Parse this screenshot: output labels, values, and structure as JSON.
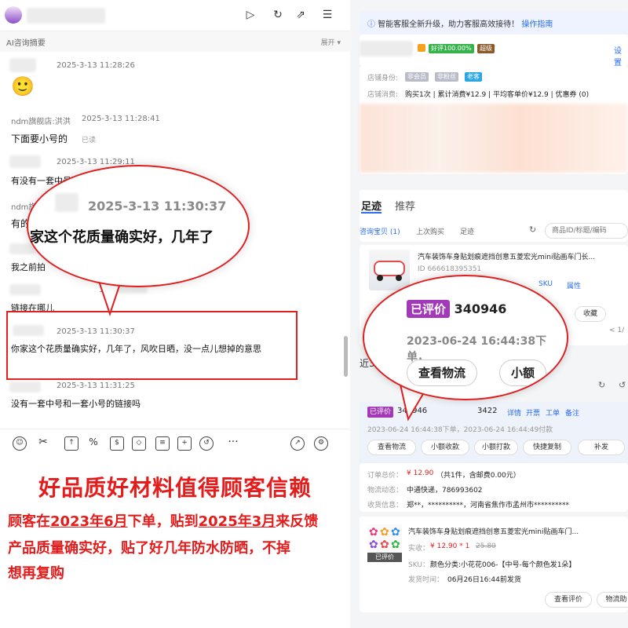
{
  "chat": {
    "ai_summary": "AI咨询摘要",
    "expand": "展开 ▾",
    "messages": [
      {
        "ts": "2025-3-13 11:28:26",
        "emoji": "🙂"
      },
      {
        "sender": "ndm旗舰店:洪洪",
        "ts": "2025-3-13 11:28:41",
        "text": "下面要小号的",
        "status": "已读"
      },
      {
        "ts": "2025-3-13 11:29:11",
        "text": "有没有一套中号"
      },
      {
        "sender": "ndm旗",
        "text": "有的"
      },
      {
        "text": "我之前拍"
      },
      {
        "ts": "11",
        "text": "链接在哪儿"
      },
      {
        "ts": "2025-3-13 11:30:37",
        "text": "你家这个花质量确实好，几年了，风吹日晒，没一点儿想掉的意思"
      },
      {
        "ts": "2025-3-13 11:31:25",
        "text": "没有一套中号和一套小号的链接吗"
      }
    ],
    "bubble": {
      "ts": "2025-3-13 11:30:37",
      "text": "家这个花质量确实好，几年了"
    }
  },
  "caption": {
    "headline": "好品质好材料值得顾客信赖",
    "line1_a": "顾客在",
    "line1_b": "2023年6月",
    "line1_c": "下单，贴到",
    "line1_d": "2025年3月",
    "line1_e": "来反馈",
    "line2": "产品质量确实好，贴了好几年防水防晒，不掉",
    "line3": "想再复购"
  },
  "right": {
    "notice": "智能客服全新升级，助力客服高效接待！",
    "notice_link": "操作指南",
    "settings": "设置",
    "badge_rate": "好评100.00%",
    "badge_level": "超级",
    "shop_identity_label": "店铺身份:",
    "tags": [
      "非会员",
      "非粉丝",
      "老客"
    ],
    "shop_spend_label": "店铺消费:",
    "shop_spend": "购买1次 | 累计消费¥12.9 | 平均客单价¥12.9 | 优惠券 (0)",
    "tabs": [
      "足迹",
      "推荐"
    ],
    "subtabs": [
      "咨询宝贝 (1)",
      "上次购买",
      "足迹"
    ],
    "search_placeholder": "商品ID/标题/编码",
    "product_title": "汽车装饰车身贴划痕遮挡创意五菱宏光mini贴画车门长...",
    "product_id": "ID 666618395351",
    "sku": "SKU",
    "attr": "属性",
    "collect": "收藏",
    "page": "< 1/",
    "recent": "近3",
    "zoom": {
      "status": "已评价",
      "order": "340946",
      "time": "2023-06-24 16:44:38下单，",
      "btn1": "查看物流",
      "btn2": "小额"
    },
    "order": {
      "status": "已评价",
      "id_a": "340946",
      "id_b": "3422",
      "links": [
        "详情",
        "开票",
        "工单",
        "备注"
      ],
      "times": "2023-06-24 16:44:38下单，2023-06-24 16:44:49付款",
      "buttons": [
        "查看物流",
        "小额收款",
        "小额打款",
        "快捷复制",
        "补发"
      ],
      "total_label": "订单总价：",
      "total": "¥ 12.90",
      "total_note": "（共1件，含邮费0.00元）",
      "logistics_label": "物流动态：",
      "logistics": "中通快递，786993602",
      "address_label": "收货信息：",
      "address": "郑**，**********，河南省焦作市孟州市**********",
      "item_title": "汽车装饰车身贴划痕遮挡创意五菱宏光mini贴画车门...",
      "item_status": "已评价",
      "paid_label": "实收：",
      "paid": "¥ 12.90 * 1",
      "orig": "25.80",
      "sku_label": "SKU：",
      "sku": "颜色分类:小花花006-【中号-每个颜色发1朵】",
      "ship_label": "发货时间：",
      "ship": "06月26日16:44前发货",
      "bottom_buttons": [
        "查看评价",
        "物流助"
      ]
    }
  }
}
